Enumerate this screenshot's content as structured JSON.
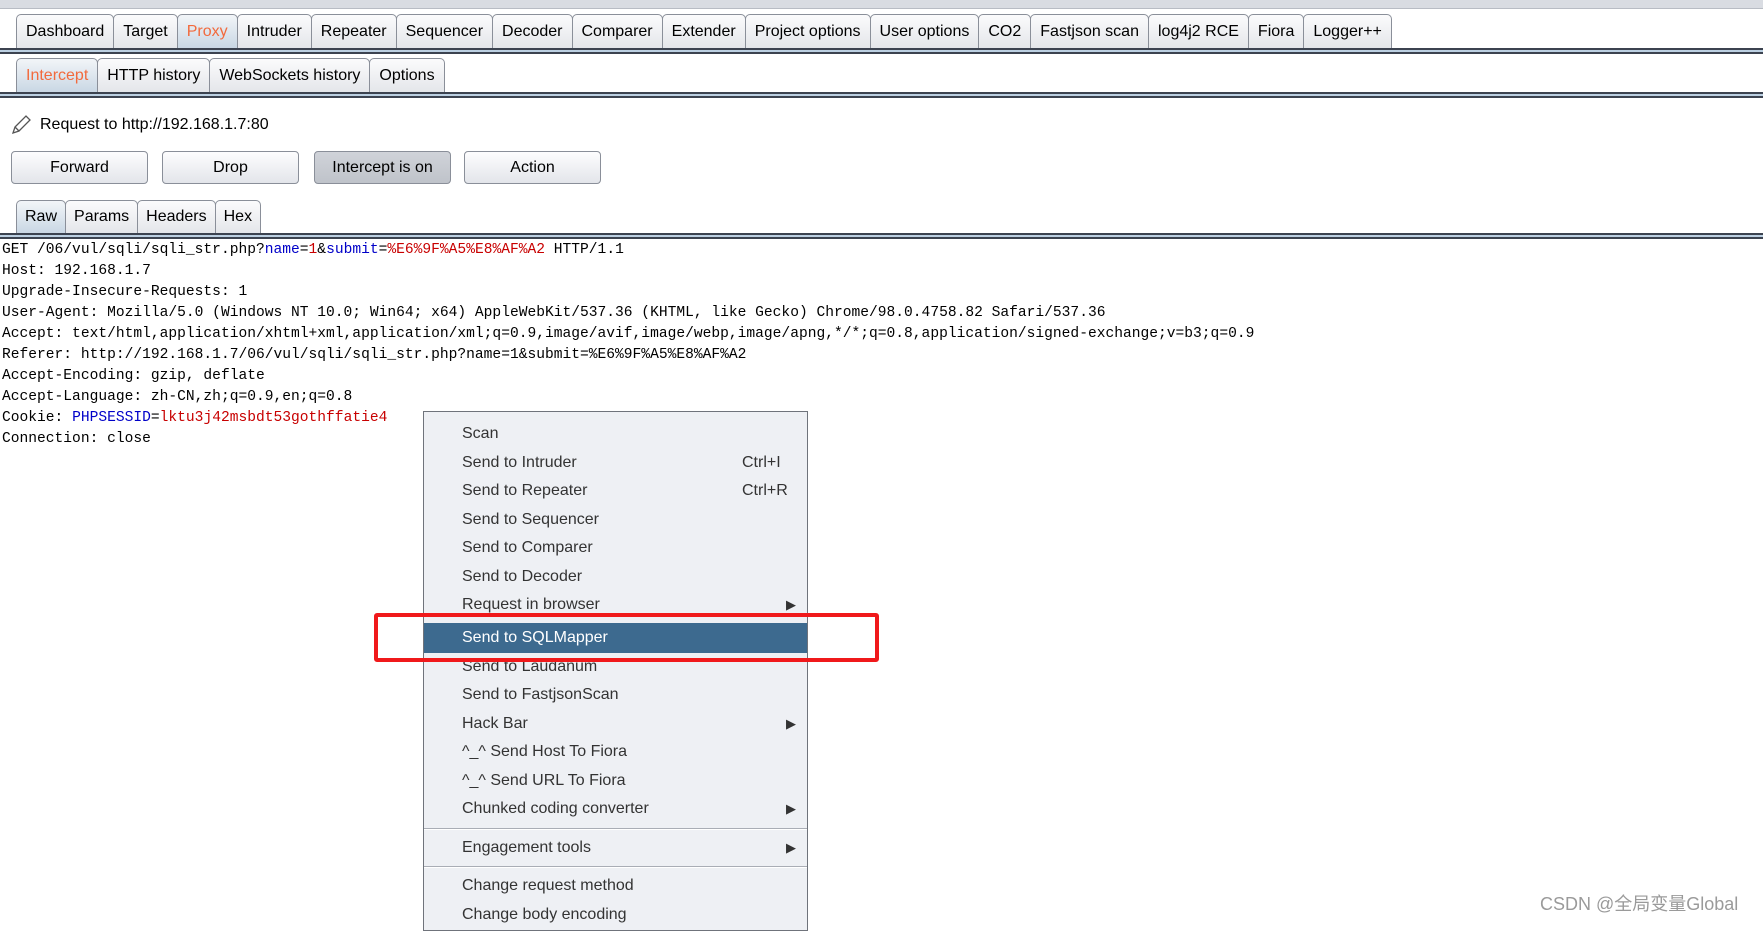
{
  "main_tabs": [
    "Dashboard",
    "Target",
    "Proxy",
    "Intruder",
    "Repeater",
    "Sequencer",
    "Decoder",
    "Comparer",
    "Extender",
    "Project options",
    "User options",
    "CO2",
    "Fastjson scan",
    "log4j2 RCE",
    "Fiora",
    "Logger++"
  ],
  "main_active": 2,
  "proxy_tabs": [
    "Intercept",
    "HTTP history",
    "WebSockets history",
    "Options"
  ],
  "proxy_active": 0,
  "request_label": "Request to http://192.168.1.7:80",
  "buttons": {
    "forward": "Forward",
    "drop": "Drop",
    "intercept": "Intercept is on",
    "action": "Action"
  },
  "view_tabs": [
    "Raw",
    "Params",
    "Headers",
    "Hex"
  ],
  "view_active": 0,
  "request_lines": [
    [
      {
        "t": "GET /06/vul/sqli/sqli_str.php?"
      },
      {
        "t": "name",
        "c": "n"
      },
      {
        "t": "="
      },
      {
        "t": "1",
        "c": "v"
      },
      {
        "t": "&"
      },
      {
        "t": "submit",
        "c": "n"
      },
      {
        "t": "="
      },
      {
        "t": "%E6%9F%A5%E8%AF%A2",
        "c": "v"
      },
      {
        "t": " HTTP/1.1"
      }
    ],
    [
      {
        "t": "Host: 192.168.1.7"
      }
    ],
    [
      {
        "t": "Upgrade-Insecure-Requests: 1"
      }
    ],
    [
      {
        "t": "User-Agent: Mozilla/5.0 (Windows NT 10.0; Win64; x64) AppleWebKit/537.36 (KHTML, like Gecko) Chrome/98.0.4758.82 Safari/537.36"
      }
    ],
    [
      {
        "t": "Accept: text/html,application/xhtml+xml,application/xml;q=0.9,image/avif,image/webp,image/apng,*/*;q=0.8,application/signed-exchange;v=b3;q=0.9"
      }
    ],
    [
      {
        "t": "Referer: http://192.168.1.7/06/vul/sqli/sqli_str.php?name=1&submit=%E6%9F%A5%E8%AF%A2"
      }
    ],
    [
      {
        "t": "Accept-Encoding: gzip, deflate"
      }
    ],
    [
      {
        "t": "Accept-Language: zh-CN,zh;q=0.9,en;q=0.8"
      }
    ],
    [
      {
        "t": "Cookie: "
      },
      {
        "t": "PHPSESSID",
        "c": "n"
      },
      {
        "t": "="
      },
      {
        "t": "lktu3j42msbdt53gothffatie4",
        "c": "v"
      }
    ],
    [
      {
        "t": "Connection: close"
      }
    ]
  ],
  "context_menu": [
    {
      "label": "Scan"
    },
    {
      "label": "Send to Intruder",
      "shortcut": "Ctrl+I"
    },
    {
      "label": "Send to Repeater",
      "shortcut": "Ctrl+R"
    },
    {
      "label": "Send to Sequencer"
    },
    {
      "label": "Send to Comparer"
    },
    {
      "label": "Send to Decoder"
    },
    {
      "label": "Request in browser",
      "submenu": true
    },
    {
      "label": "Send to SQLMapper",
      "highlighted": true
    },
    {
      "label": "Send to Laudanum"
    },
    {
      "label": "Send to FastjsonScan"
    },
    {
      "label": "Hack Bar",
      "submenu": true
    },
    {
      "label": "^_^ Send Host To Fiora"
    },
    {
      "label": "^_^ Send URL To Fiora"
    },
    {
      "label": "Chunked coding converter",
      "submenu": true
    },
    {
      "separator": true
    },
    {
      "label": "Engagement tools",
      "submenu": true
    },
    {
      "separator": true
    },
    {
      "label": "Change request method"
    },
    {
      "label": "Change body encoding"
    }
  ],
  "colors": {
    "accent": "#f26a3d",
    "highlight": "#3d6a8f",
    "annotation": "#f0191b",
    "param_name": "#0000c8",
    "param_value": "#c80000"
  },
  "icons": {
    "request": "pencil-icon",
    "submenu": "triangle-right-icon"
  },
  "watermark": "CSDN @全局变量Global"
}
